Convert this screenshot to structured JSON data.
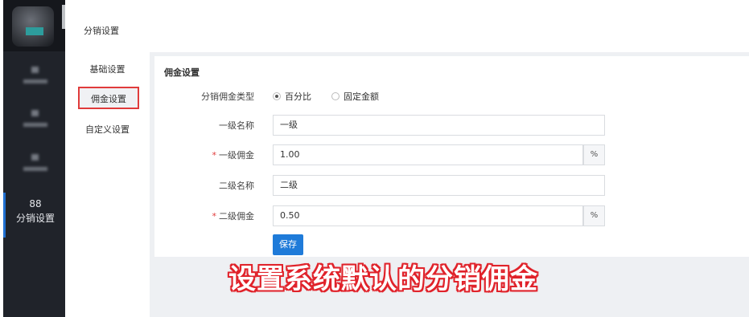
{
  "header": {
    "page_title": "分销设置"
  },
  "leftnav": {
    "items": [
      {
        "label": "",
        "icon": "blurred-icon"
      },
      {
        "label": "",
        "icon": "blurred-icon"
      },
      {
        "label": "",
        "icon": "blurred-icon"
      },
      {
        "label": "分销设置",
        "icon": "grid-icon"
      }
    ],
    "active_icon_glyph": "88"
  },
  "subnav": {
    "items": [
      {
        "label": "基础设置"
      },
      {
        "label": "佣金设置"
      },
      {
        "label": "自定义设置"
      }
    ]
  },
  "form": {
    "section_title": "佣金设置",
    "commission_type": {
      "label": "分销佣金类型",
      "options": [
        {
          "label": "百分比",
          "selected": true
        },
        {
          "label": "固定金额",
          "selected": false
        }
      ]
    },
    "level1_name": {
      "label": "一级名称",
      "value": "一级"
    },
    "level1_commission": {
      "label": "一级佣金",
      "required_mark": "*",
      "value": "1.00",
      "addon": "%"
    },
    "level2_name": {
      "label": "二级名称",
      "value": "二级"
    },
    "level2_commission": {
      "label": "二级佣金",
      "required_mark": "*",
      "value": "0.50",
      "addon": "%"
    },
    "save_label": "保存"
  },
  "overlay_caption": "设置系统默认的分销佣金",
  "colors": {
    "primary": "#1f7bd9",
    "highlight_border": "#e03b3b",
    "sidebar_bg": "#20232a"
  }
}
